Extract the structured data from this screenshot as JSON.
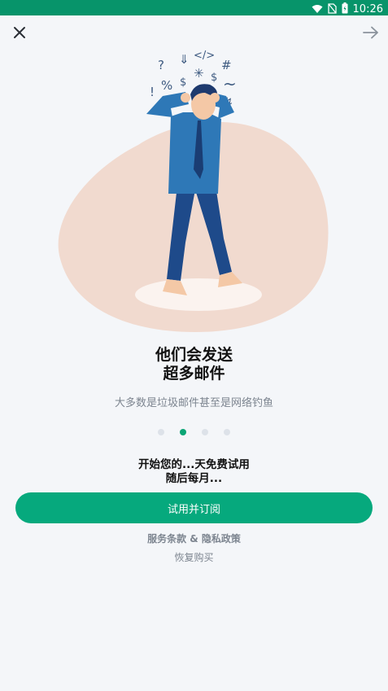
{
  "status_bar": {
    "time": "10:26",
    "icons": [
      "wifi-icon",
      "no-sim-icon",
      "battery-icon"
    ]
  },
  "top_bar": {
    "close_icon": "close-icon",
    "next_icon": "arrow-right-icon"
  },
  "illustration": {
    "symbols": [
      "?",
      "%",
      "!",
      "</>",
      "#",
      "$",
      "~",
      "*"
    ]
  },
  "onboarding": {
    "title_line1": "他们会发送",
    "title_line2": "超多邮件",
    "subtitle": "大多数是垃圾邮件甚至是网络钓鱼",
    "page_total": 4,
    "page_active": 2
  },
  "trial": {
    "line1": "开始您的...天免费试用",
    "line2": "随后每月..."
  },
  "cta_label": "试用并订阅",
  "terms_link": "服务条款 & 隐私政策",
  "restore_link": "恢复购买",
  "colors": {
    "status_bar": "#07946a",
    "accent": "#06a97d",
    "background": "#f4f6f9"
  }
}
